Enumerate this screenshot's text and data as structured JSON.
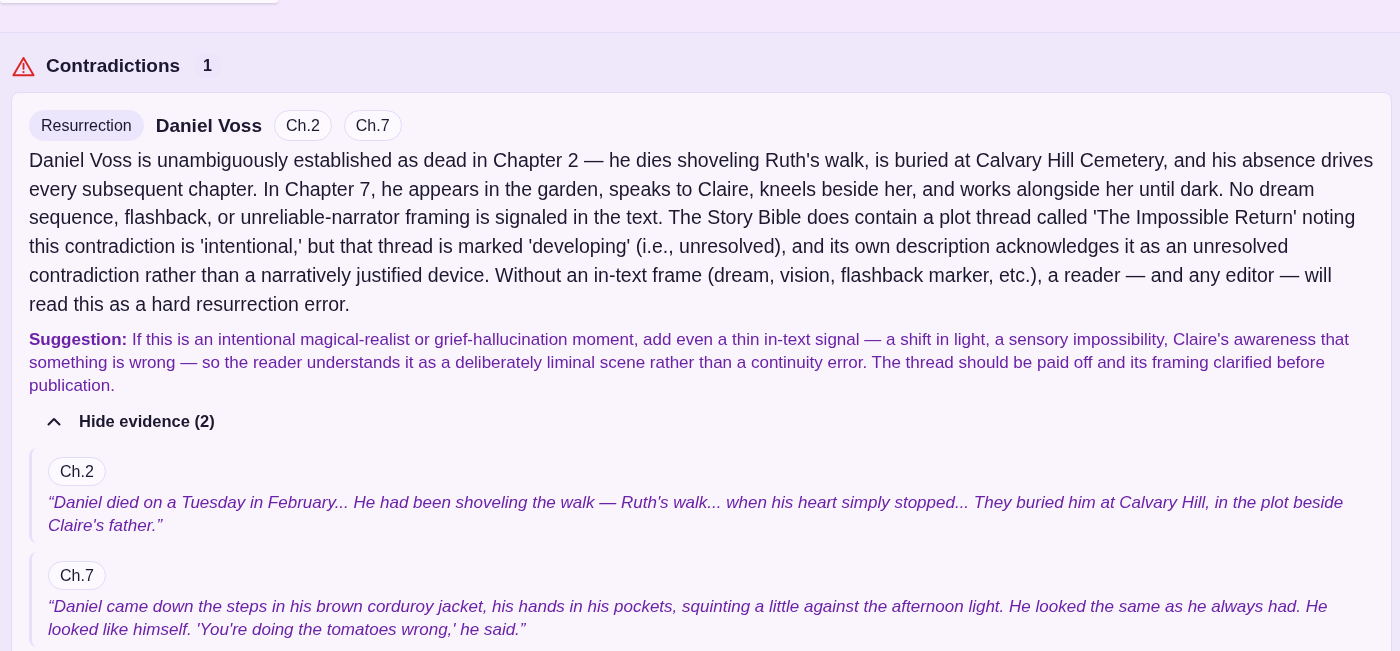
{
  "section": {
    "title": "Contradictions",
    "count": "1"
  },
  "issues": [
    {
      "category": "Resurrection",
      "character": "Daniel Voss",
      "chapters": [
        "Ch.2",
        "Ch.7"
      ],
      "description": "Daniel Voss is unambiguously established as dead in Chapter 2 — he dies shoveling Ruth's walk, is buried at Calvary Hill Cemetery, and his absence drives every subsequent chapter. In Chapter 7, he appears in the garden, speaks to Claire, kneels beside her, and works alongside her until dark. No dream sequence, flashback, or unreliable-narrator framing is signaled in the text. The Story Bible does contain a plot thread called 'The Impossible Return' noting this contradiction is 'intentional,' but that thread is marked 'developing' (i.e., unresolved), and its own description acknowledges it as an unresolved contradiction rather than a narratively justified device. Without an in-text frame (dream, vision, flashback marker, etc.), a reader — and any editor — will read this as a hard resurrection error.",
      "suggestion": "**Suggestion:** If this is an intentional magical-realist or grief-hallucination moment, add even a thin in-text signal — a shift in light, a sensory impossibility, Claire's awareness that something is wrong — so the reader understands it as a deliberately liminal scene rather than a continuity error. The thread should be paid off and its framing clarified before publication.",
      "evidence_toggle": {
        "label": "Hide evidence (2)",
        "expanded": true
      },
      "evidence": [
        {
          "chapter": "Ch.2",
          "quote": "“Daniel died on a Tuesday in February... He had been shoveling the walk — Ruth's walk... when his heart simply stopped... They buried him at Calvary Hill, in the plot beside Claire's father.”"
        },
        {
          "chapter": "Ch.7",
          "quote": "“Daniel came down the steps in his brown corduroy jacket, his hands in his pockets, squinting a little against the afternoon light. He looked the same as he always had. He looked like himself. 'You're doing the tomatoes wrong,' he said.”"
        }
      ]
    }
  ]
}
